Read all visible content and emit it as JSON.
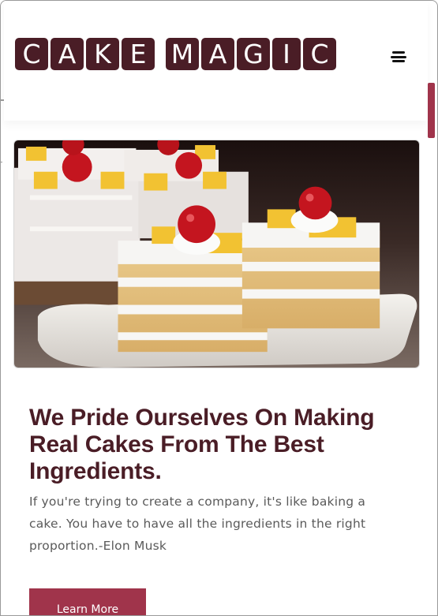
{
  "brand": {
    "logo_word1": [
      "C",
      "A",
      "K",
      "E"
    ],
    "logo_word2": [
      "M",
      "A",
      "G",
      "I",
      "C"
    ],
    "tile_color": "#4a1d26"
  },
  "nav": {
    "menu_icon": "hamburger-menu-icon"
  },
  "hero": {
    "image_subject": "slices of layered white cream cake with cherry and pineapple on a plate"
  },
  "content": {
    "heading": "We Pride Ourselves On Making Real Cakes From The Best Ingredients.",
    "quote": "If you're trying to create a company, it's like baking a cake. You have to have all the ingredients in the right proportion.-Elon Musk",
    "cta_label": "Learn More"
  },
  "colors": {
    "accent": "#a0344b",
    "heading": "#4a1d26",
    "body_text": "#5a5a5a"
  }
}
